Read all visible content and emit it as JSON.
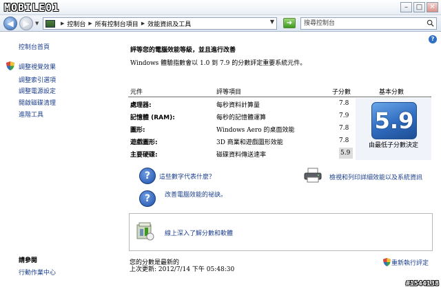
{
  "watermark": "MOBILE01",
  "window_buttons": {
    "minimize": "–",
    "maximize": "□",
    "close": "✕"
  },
  "address": {
    "crumbs": [
      "控制台",
      "所有控制台項目",
      "效能資訊及工具"
    ],
    "search_placeholder": "搜尋控制台"
  },
  "sidebar": {
    "items": [
      {
        "label": "控制台首頁"
      },
      {
        "label": "調整視覺效果"
      },
      {
        "label": "調整索引選項"
      },
      {
        "label": "調整電源設定"
      },
      {
        "label": "開啟磁碟清理"
      },
      {
        "label": "進階工具"
      }
    ],
    "see_also_title": "請參閱",
    "see_also_link": "行動作業中心"
  },
  "main": {
    "heading": "評等您的電腦效能等級，並且進行改善",
    "description": "Windows 體驗指數會以 1.0 到 7.9 的分數評定重要系統元件。",
    "table": {
      "headers": {
        "component": "元件",
        "rated": "評等項目",
        "subscore": "子分數",
        "base": "基本分數"
      },
      "rows": [
        {
          "component": "處理器:",
          "rated": "每秒資料計算量",
          "subscore": "7.8"
        },
        {
          "component": "記憶體 (RAM):",
          "rated": "每秒的記憶體運算",
          "subscore": "7.9"
        },
        {
          "component": "圖形:",
          "rated": "Windows Aero 的桌面效能",
          "subscore": "7.8"
        },
        {
          "component": "遊戲圖形:",
          "rated": "3D 商業和遊戲圖形效能",
          "subscore": "7.8"
        },
        {
          "component": "主要硬碟:",
          "rated": "磁碟資料傳送速率",
          "subscore": "5.9"
        }
      ],
      "base_score": "5.9",
      "base_note": "由最低子分數決定"
    },
    "links": {
      "what_mean": "這些數字代表什麼？",
      "print_details": "檢視和列印詳細效能以及系統資訊",
      "tips": "改善電腦效能的祕訣。",
      "learn_more": "線上深入了解分數和軟體"
    },
    "status": {
      "line1": "您的分數是最新的",
      "line2": "上次更新: 2012/7/14 下午 05:48:30",
      "rerun": "重新執行評定"
    }
  },
  "corner_tag": "#1544138",
  "colors": {
    "link": "#1c3f8d",
    "badge": "#2f6bbf",
    "panel": "#f1f3fb"
  }
}
